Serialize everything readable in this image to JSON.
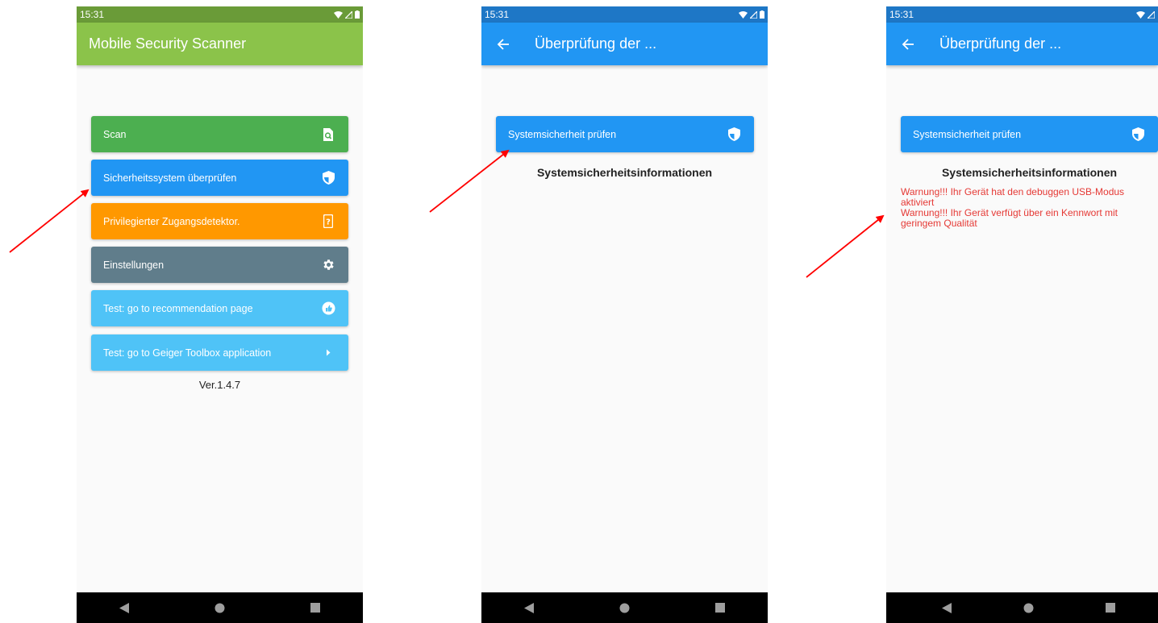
{
  "status": {
    "time": "15:31"
  },
  "screen1": {
    "title": "Mobile Security Scanner",
    "buttons": [
      {
        "label": "Scan",
        "color": "#4caf50",
        "icon": "search-doc-icon"
      },
      {
        "label": "Sicherheitssystem überprüfen",
        "color": "#2196f3",
        "icon": "shield-icon"
      },
      {
        "label": "Privilegierter Zugangsdetektor.",
        "color": "#ff9800",
        "icon": "phone-question-icon"
      },
      {
        "label": "Einstellungen",
        "color": "#607d8b",
        "icon": "gear-icon"
      },
      {
        "label": "Test: go to recommendation page",
        "color": "#4fc3f7",
        "icon": "thumb-up-icon"
      },
      {
        "label": "Test: go to Geiger Toolbox application",
        "color": "#4fc3f7",
        "icon": "play-arrow-icon"
      }
    ],
    "version": "Ver.1.4.7"
  },
  "screen2": {
    "title": "Überprüfung der ...",
    "check_button": {
      "label": "Systemsicherheit prüfen",
      "color": "#2196f3",
      "icon": "shield-icon"
    },
    "info_title": "Systemsicherheitsinformationen"
  },
  "screen3": {
    "title": "Überprüfung der ...",
    "check_button": {
      "label": "Systemsicherheit prüfen",
      "color": "#2196f3",
      "icon": "shield-icon"
    },
    "info_title": "Systemsicherheitsinformationen",
    "warnings": [
      "Warnung!!! Ihr Gerät hat den debuggen USB-Modus aktiviert",
      "Warnung!!! Ihr Gerät verfügt über ein Kennwort mit geringem Qualität"
    ],
    "warning_color": "#e53935"
  }
}
